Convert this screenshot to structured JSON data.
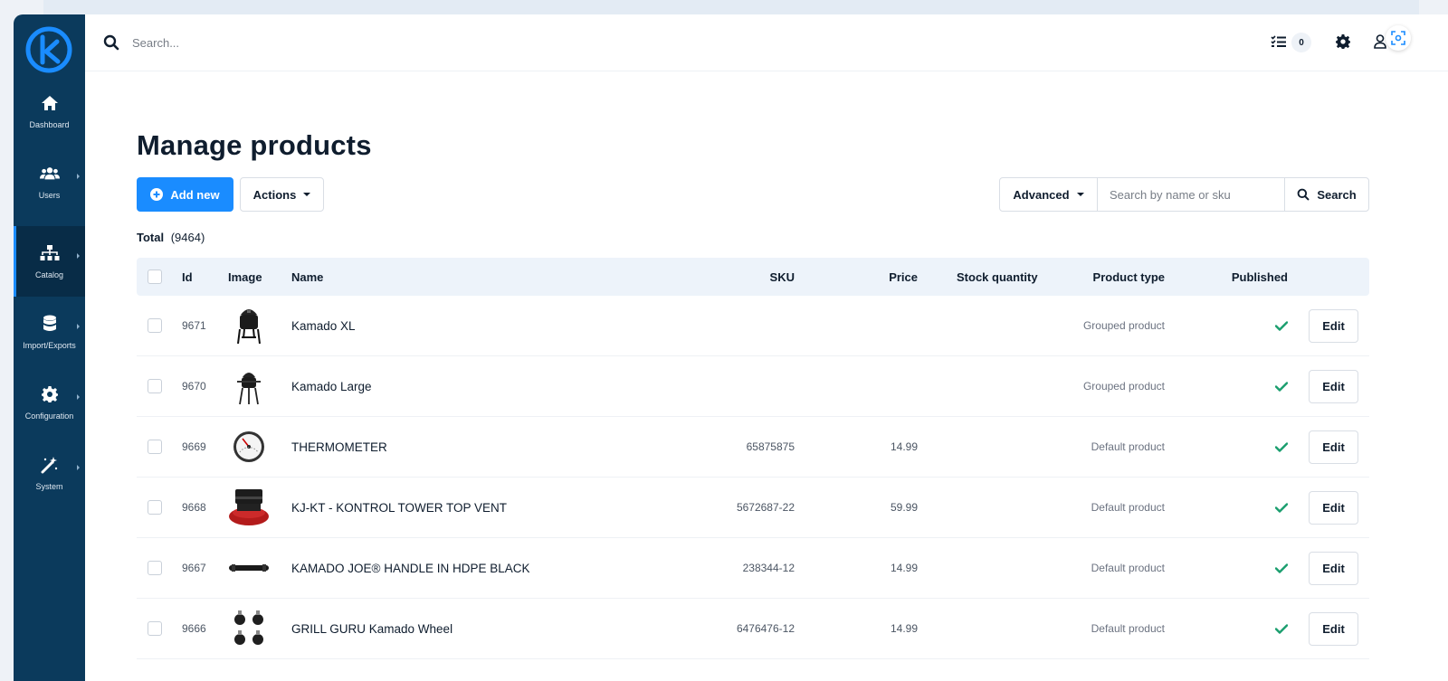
{
  "sidebar": {
    "items": [
      {
        "label": "Dashboard",
        "icon": "home-icon"
      },
      {
        "label": "Users",
        "icon": "users-icon"
      },
      {
        "label": "Catalog",
        "icon": "sitemap-icon"
      },
      {
        "label": "Import/Exports",
        "icon": "database-icon"
      },
      {
        "label": "Configuration",
        "icon": "gear-icon"
      },
      {
        "label": "System",
        "icon": "magic-wand-icon"
      }
    ]
  },
  "topbar": {
    "search_placeholder": "Search...",
    "tasks_count": "0"
  },
  "page": {
    "title": "Manage products",
    "add_new_label": "Add new",
    "actions_label": "Actions",
    "advanced_label": "Advanced",
    "search_placeholder": "Search by name or sku",
    "search_label": "Search",
    "total_label": "Total",
    "total_value": "(9464)"
  },
  "table": {
    "columns": [
      "Id",
      "Image",
      "Name",
      "SKU",
      "Price",
      "Stock quantity",
      "Product type",
      "Published"
    ],
    "edit_label": "Edit",
    "rows": [
      {
        "id": "9671",
        "name": "Kamado XL",
        "sku": "",
        "price": "",
        "stock": "",
        "type": "Grouped product",
        "published": true,
        "image": "kamado-xl-image"
      },
      {
        "id": "9670",
        "name": "Kamado Large",
        "sku": "",
        "price": "",
        "stock": "",
        "type": "Grouped product",
        "published": true,
        "image": "kamado-large-image"
      },
      {
        "id": "9669",
        "name": "THERMOMETER",
        "sku": "65875875",
        "price": "14.99",
        "stock": "",
        "type": "Default product",
        "published": true,
        "image": "thermometer-image"
      },
      {
        "id": "9668",
        "name": "KJ-KT - KONTROL TOWER TOP VENT",
        "sku": "5672687-22",
        "price": "59.99",
        "stock": "",
        "type": "Default product",
        "published": true,
        "image": "top-vent-image"
      },
      {
        "id": "9667",
        "name": "KAMADO JOE® HANDLE IN HDPE BLACK",
        "sku": "238344-12",
        "price": "14.99",
        "stock": "",
        "type": "Default product",
        "published": true,
        "image": "handle-image"
      },
      {
        "id": "9666",
        "name": "GRILL GURU Kamado Wheel",
        "sku": "6476476-12",
        "price": "14.99",
        "stock": "",
        "type": "Default product",
        "published": true,
        "image": "wheel-image"
      }
    ]
  },
  "colors": {
    "sidebar": "#0b3a5c",
    "accent": "#1a8cff",
    "published_check": "#1a9e6e"
  }
}
